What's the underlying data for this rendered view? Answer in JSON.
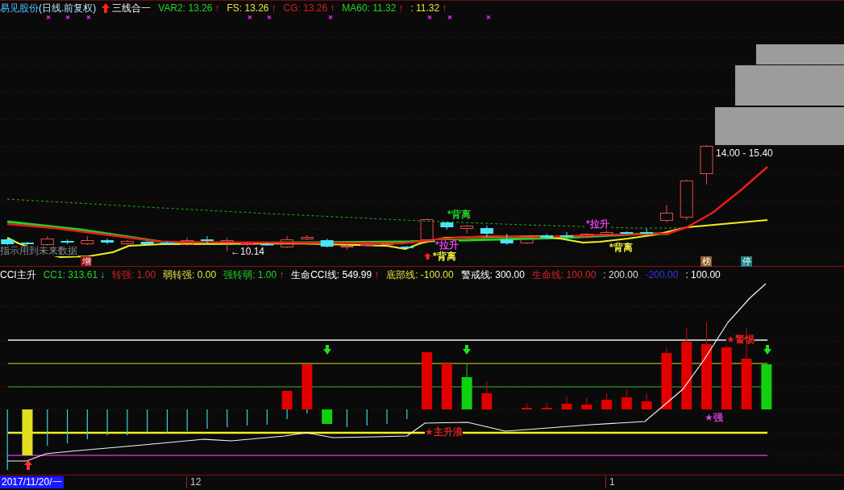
{
  "header": {
    "stock_name": "易见股份",
    "period": "(日线.前复权)",
    "indicator": "三线合一",
    "legend": [
      {
        "text": "VAR2: 13.26",
        "color": "#22d422",
        "rising": true,
        "arrow": "↑"
      },
      {
        "text": "FS: 13.26",
        "color": "#e6e640",
        "rising": true,
        "arrow": "↑"
      },
      {
        "text": "CG: 13.26",
        "color": "#d22020",
        "rising": true,
        "arrow": "↑"
      },
      {
        "text": "MA60: 11.32",
        "color": "#22d422",
        "rising": true,
        "arrow": "↑"
      },
      {
        "text": ": 11.32",
        "color": "#e6e640",
        "rising": true,
        "arrow": "↑"
      }
    ]
  },
  "price_chart": {
    "annotations": [
      {
        "kind": "note",
        "text": "指示用到未来数据"
      },
      {
        "kind": "tag",
        "text": "增",
        "color": "#8c1010"
      },
      {
        "kind": "price",
        "text": "←10.14"
      },
      {
        "kind": "signal",
        "text": "*背离",
        "color": "#22d422"
      },
      {
        "kind": "signal",
        "text": "*拉升",
        "color": "#e040e0"
      },
      {
        "kind": "signal",
        "text": "*背离",
        "color": "#f0f040"
      },
      {
        "kind": "signal",
        "text": "*拉升",
        "color": "#e040e0"
      },
      {
        "kind": "signal",
        "text": "*背离",
        "color": "#f0f040"
      },
      {
        "kind": "tag",
        "text": "榜",
        "color": "#8a5a24"
      },
      {
        "kind": "tag",
        "text": "停",
        "color": "#1f7f80"
      },
      {
        "kind": "price",
        "text": "14.00 - 15.40"
      }
    ]
  },
  "cci_panel": {
    "title": "CCI主升",
    "legend": [
      {
        "text": "CC1: 313.61",
        "color": "#22d422",
        "rising": false,
        "arrow": "↓"
      },
      {
        "text": "转强: 1.00",
        "color": "#e02020"
      },
      {
        "text": "弱转强: 0.00",
        "color": "#e6e640"
      },
      {
        "text": "强转弱: 1.00",
        "color": "#22d422",
        "rising": true,
        "arrow": "↑"
      },
      {
        "text": "生命CCI线: 549.99",
        "color": "#ffffff",
        "rising": true,
        "arrow": "↑"
      },
      {
        "text": "底部线: -100.00",
        "color": "#e6e640"
      },
      {
        "text": "警戒线: 300.00",
        "color": "#ffffff"
      },
      {
        "text": "生命线: 100.00",
        "color": "#e02020"
      },
      {
        "text": ": 200.00",
        "color": "#dddddd"
      },
      {
        "text": "-200.00",
        "color": "#3535f0"
      },
      {
        "text": ": 100.00",
        "color": "#ffffff"
      }
    ],
    "annotations": [
      {
        "text": "★主升浪",
        "color": "#e02020"
      },
      {
        "text": "★警惕",
        "color": "#e02020"
      },
      {
        "text": "★强",
        "color": "#e040e0"
      }
    ]
  },
  "x_axis": {
    "cursor_date": "2017/11/20/一",
    "ticks": [
      "12",
      "1"
    ]
  }
}
